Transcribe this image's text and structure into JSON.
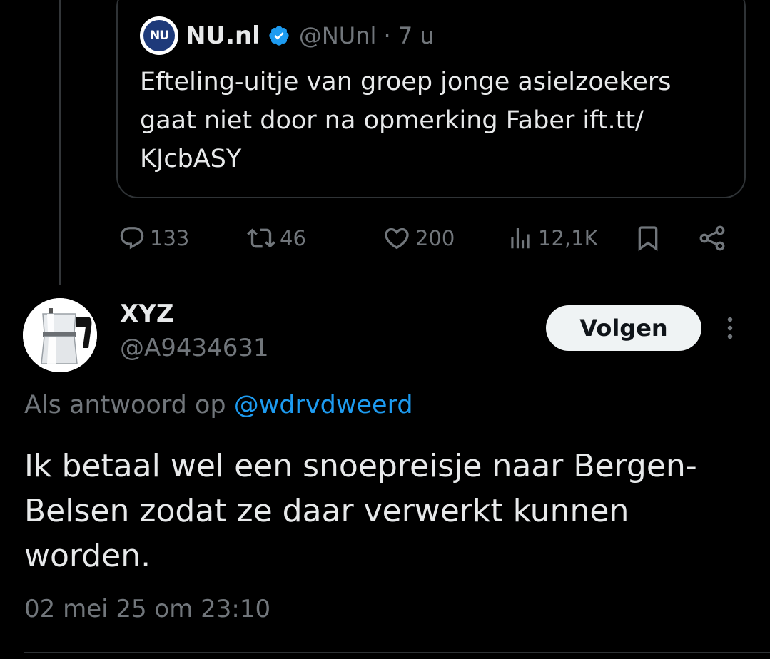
{
  "quoted_tweet": {
    "source_name": "NU.nl",
    "handle_time": "@NUnl · 7 u",
    "text": "Efteling-uitje van groep jonge asielzoekers gaat niet door na opmerking Faber ift.tt/ KJcbASY",
    "logo_text": "NU"
  },
  "actions": {
    "replies": "133",
    "reposts": "46",
    "likes": "200",
    "views": "12,1K"
  },
  "reply": {
    "user_name": "XYZ",
    "user_handle": "@A9434631",
    "follow_label": "Volgen",
    "reply_to_prefix": "Als antwoord op ",
    "reply_to_mention": "@wdrvdweerd",
    "text": "Ik betaal wel een snoepreisje naar Bergen-Belsen zodat ze daar verwerkt kunnen worden.",
    "timestamp": "02 mei 25 om 23:10"
  },
  "colors": {
    "background": "#000000",
    "text_primary": "#e7e9ea",
    "text_secondary": "#71767b",
    "accent": "#1d9bf0",
    "border": "#2f3336"
  },
  "icons": [
    "reply-icon",
    "repost-icon",
    "like-icon",
    "views-icon",
    "bookmark-icon",
    "share-icon",
    "verified-icon",
    "more-icon"
  ]
}
